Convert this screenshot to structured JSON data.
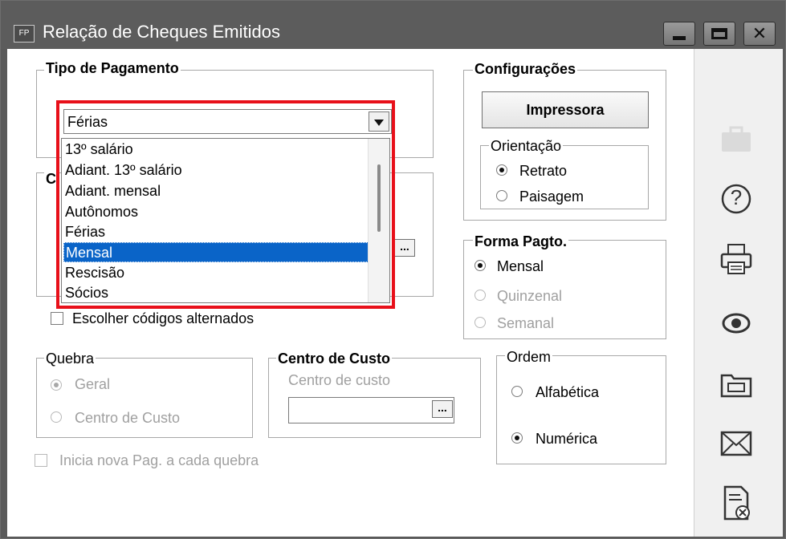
{
  "window": {
    "icon_text": "FP",
    "title": "Relação de Cheques Emitidos",
    "min_label": "minimize",
    "max_label": "maximize",
    "close_glyph": "✕"
  },
  "tipo_pagamento": {
    "title": "Tipo de Pagamento",
    "selected": "Férias",
    "options": [
      "13º salário",
      "Adiant. 13º salário",
      "Adiant. mensal",
      "Autônomos",
      "Férias",
      "Mensal",
      "Rescisão",
      "Sócios"
    ],
    "highlighted": "Mensal"
  },
  "hidden_group_letter": "C",
  "escolher_codigos": {
    "label": "Escolher códigos alternados",
    "checked": false
  },
  "configuracoes": {
    "title": "Configurações",
    "printer_button": "Impressora",
    "orientacao": {
      "title": "Orientação",
      "options": [
        "Retrato",
        "Paisagem"
      ],
      "selected": "Retrato"
    }
  },
  "forma_pagto": {
    "title": "Forma Pagto.",
    "options": [
      "Mensal",
      "Quinzenal",
      "Semanal"
    ],
    "selected": "Mensal",
    "disabled": [
      "Quinzenal",
      "Semanal"
    ]
  },
  "quebra": {
    "title": "Quebra",
    "options": [
      "Geral",
      "Centro de Custo"
    ],
    "selected": "Geral",
    "disabled": true
  },
  "centro_custo": {
    "title": "Centro de Custo",
    "field_label": "Centro de custo",
    "value": "",
    "browse_button": "..."
  },
  "ordem": {
    "title": "Ordem",
    "options": [
      "Alfabética",
      "Numérica"
    ],
    "selected": "Numérica"
  },
  "inicia_nova_pag": {
    "label": "Inicia nova Pag. a cada quebra",
    "checked": false,
    "disabled": true
  },
  "hidden_browse_button": "...",
  "side_toolbar": {
    "icons": [
      "briefcase-icon",
      "help-icon",
      "printer-icon",
      "preview-eye-icon",
      "folder-icon",
      "envelope-icon",
      "close-document-icon"
    ],
    "help_glyph": "?"
  },
  "colors": {
    "titlebar": "#5c5c5c",
    "selection": "#0a64c8",
    "highlight_box": "#e8101a"
  }
}
